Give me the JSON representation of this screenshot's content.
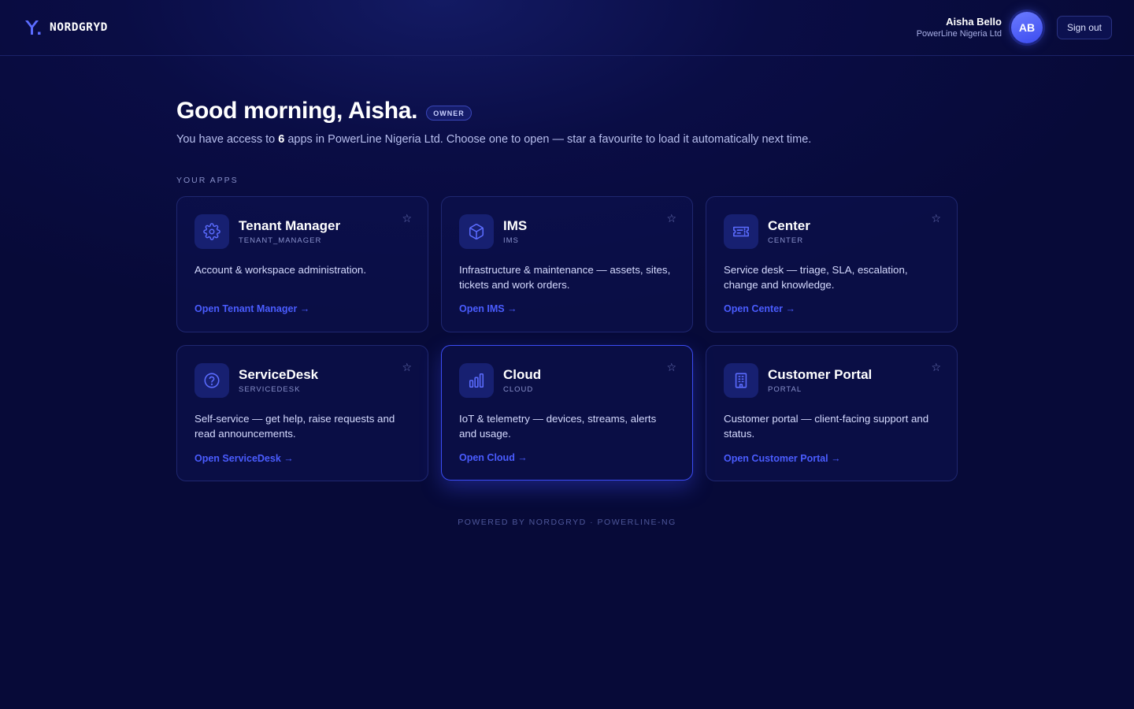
{
  "brand": {
    "mark": "Y.",
    "name": "NORDGRYD"
  },
  "user": {
    "name": "Aisha Bello",
    "org": "PowerLine Nigeria Ltd",
    "initials": "AB",
    "sign_out": "Sign out"
  },
  "greeting": {
    "title": "Good morning, Aisha.",
    "role": "OWNER",
    "sub_before": "You have access to ",
    "app_count": "6",
    "sub_after": " apps in PowerLine Nigeria Ltd. Choose one to open — star a favourite to load it automatically next time."
  },
  "section_label": "YOUR APPS",
  "apps": [
    {
      "title": "Tenant Manager",
      "code": "TENANT_MANAGER",
      "icon": "gear-icon",
      "desc": "Account & workspace administration.",
      "link": "Open Tenant Manager →",
      "star": "☆"
    },
    {
      "title": "IMS",
      "code": "IMS",
      "icon": "cube-icon",
      "desc": "Infrastructure & maintenance — assets, sites, tickets and work orders.",
      "link": "Open IMS →",
      "star": "☆"
    },
    {
      "title": "Center",
      "code": "CENTER",
      "icon": "ticket-icon",
      "desc": "Service desk — triage, SLA, escalation, change and knowledge.",
      "link": "Open Center →",
      "star": "☆"
    },
    {
      "title": "ServiceDesk",
      "code": "SERVICEDESK",
      "icon": "help-circle-icon",
      "desc": "Self-service — get help, raise requests and read announcements.",
      "link": "Open ServiceDesk →",
      "star": "☆"
    },
    {
      "title": "Cloud",
      "code": "CLOUD",
      "icon": "bar-chart-icon",
      "desc": "IoT & telemetry — devices, streams, alerts and usage.",
      "link": "Open Cloud →",
      "star": "☆"
    },
    {
      "title": "Customer Portal",
      "code": "PORTAL",
      "icon": "building-icon",
      "desc": "Customer portal — client-facing support and status.",
      "link": "Open Customer Portal →",
      "star": "☆"
    }
  ],
  "footer": "POWERED BY NORDGRYD · POWERLINE-NG",
  "colors": {
    "accent": "#4a5cff",
    "background": "#070a38",
    "card_border": "#1f2770"
  }
}
